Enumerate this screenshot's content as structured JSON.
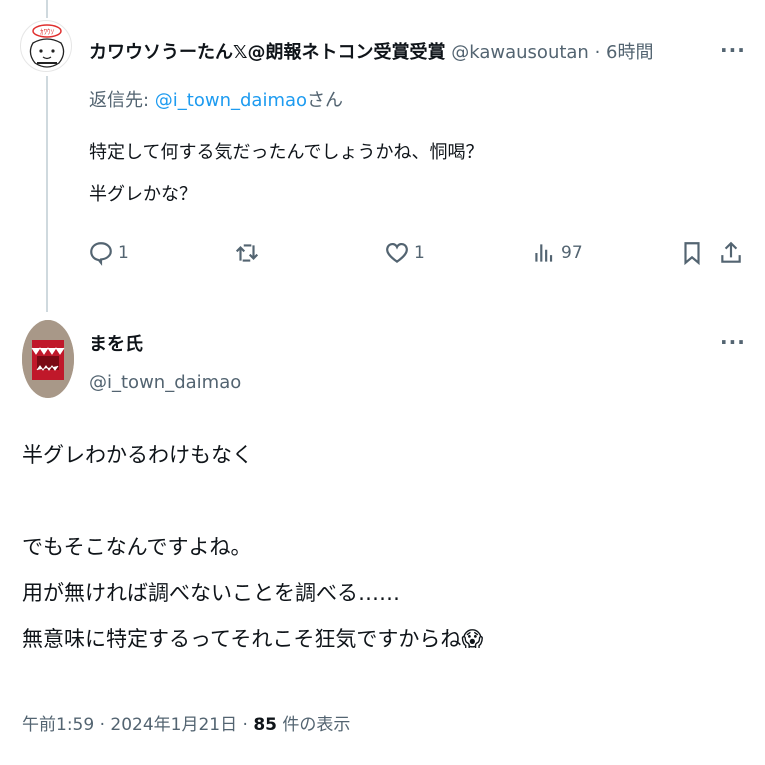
{
  "tweet1": {
    "display_name": "カワウソうーたん𝕏@朗報ネトコン受賞受賞",
    "handle_time": "@kawausoutan · 6時間",
    "reply_prefix": "返信先: ",
    "reply_handle": "@i_town_daimao",
    "reply_suffix": "さん",
    "text_line1": "特定して何する気だったんでしょうかね、恫喝？",
    "text_line2": "半グレかな？",
    "actions": {
      "replies": "1",
      "retweets": "",
      "likes": "1",
      "views": "97"
    },
    "avatar_text": "ｶﾜｳｿ"
  },
  "tweet2": {
    "display_name": "まを氏",
    "handle": "@i_town_daimao",
    "text": "半グレわかるわけもなく\n\nでもそこなんですよね。\n用が無ければ調べないことを調べる……\n無意味に特定するってそれこそ狂気ですからね😱",
    "meta_time": "午前1:59 · 2024年1月21日 · ",
    "meta_views": "85",
    "meta_views_label": " 件の表示"
  },
  "colors": {
    "link": "#1d9bf0",
    "secondary": "#536471",
    "text": "#0f1419"
  }
}
